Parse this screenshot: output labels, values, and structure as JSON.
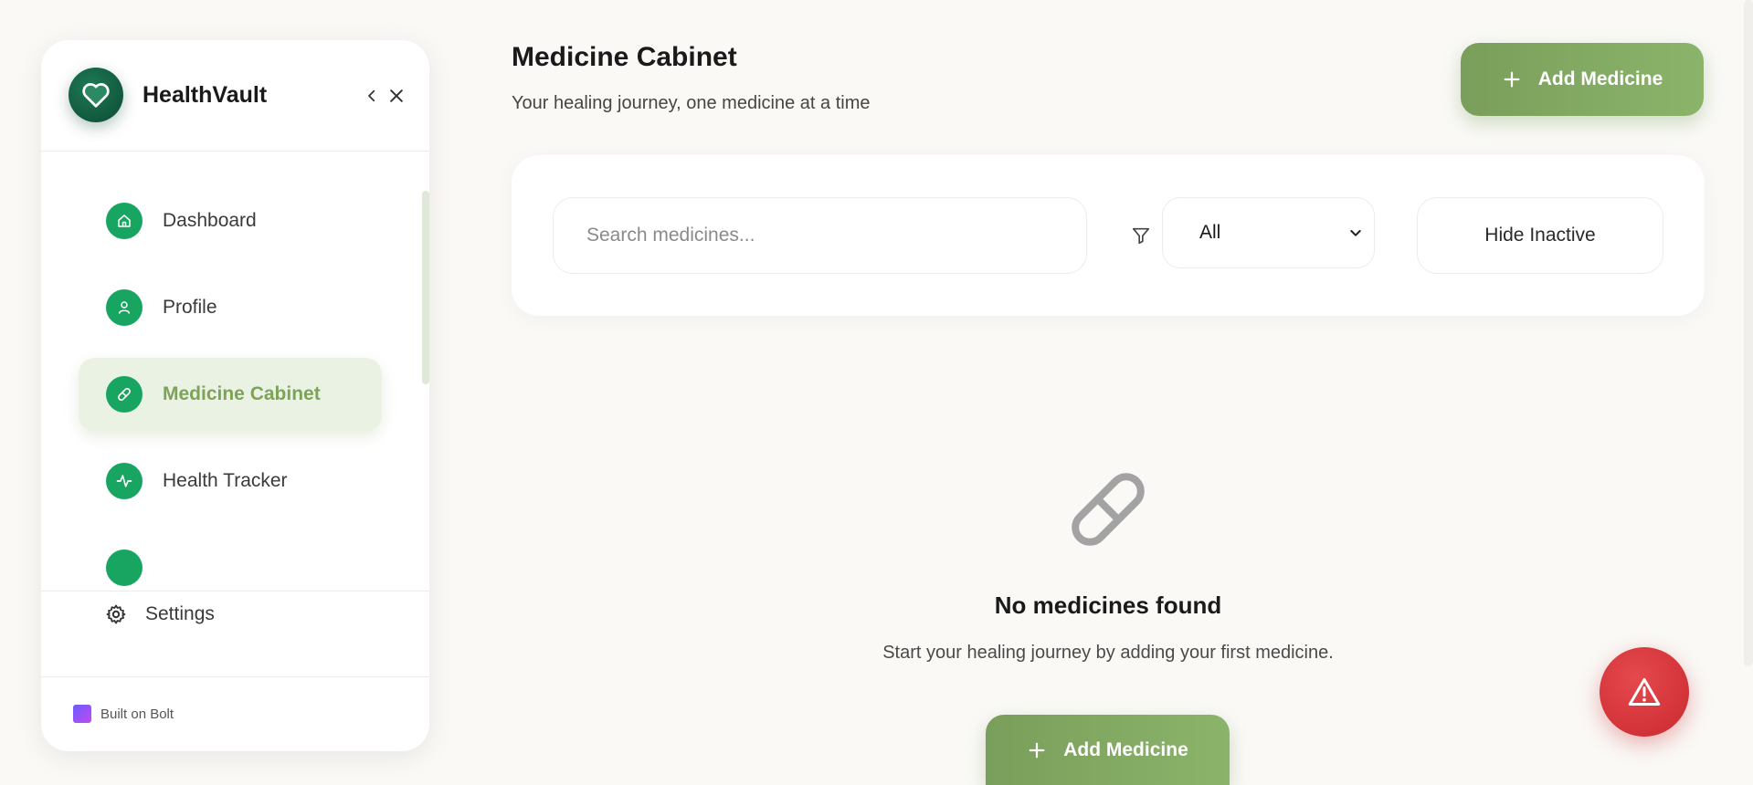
{
  "sidebar": {
    "app_name": "HealthVault",
    "items": [
      {
        "label": "Dashboard",
        "icon": "home-icon"
      },
      {
        "label": "Profile",
        "icon": "user-icon"
      },
      {
        "label": "Medicine Cabinet",
        "icon": "pill-icon",
        "active": true
      },
      {
        "label": "Health Tracker",
        "icon": "activity-icon"
      }
    ],
    "settings_label": "Settings",
    "footer": "Built on Bolt"
  },
  "header": {
    "title": "Medicine Cabinet",
    "subtitle": "Your healing journey, one medicine at a time",
    "add_label": "Add Medicine"
  },
  "filters": {
    "search_placeholder": "Search medicines...",
    "select_value": "All",
    "hide_label": "Hide Inactive"
  },
  "empty": {
    "title": "No medicines found",
    "subtitle": "Start your healing journey by adding your first medicine.",
    "add_label": "Add Medicine"
  },
  "colors": {
    "accent": "#7da356",
    "icon_green": "#17a561",
    "emergency": "#d8353b"
  }
}
